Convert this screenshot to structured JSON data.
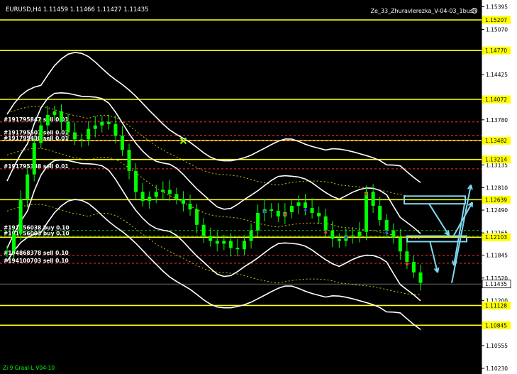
{
  "header": {
    "symbol_info": "EURUSD,H4  1.11459 1.11466 1.11427 1.11435",
    "indicator_name": "Ze_33_Zhuravlerezka_V-04-03_1bush"
  },
  "footer": {
    "indicator_label": "Zi 9 Graal-L  V04-10"
  },
  "colors": {
    "background": "#000000",
    "candle": "#00ff00",
    "level_line": "#ffff00",
    "band_line": "#ffffff",
    "ma_dotted": "#d4c000",
    "order_line_red": "#ff3030",
    "order_line_green": "#00c000",
    "arrow": "#7fd8f0",
    "axis_label_bg": "#ffff00"
  },
  "chart_data": {
    "type": "candlestick",
    "symbol": "EURUSD",
    "timeframe": "H4",
    "ohlc_current": {
      "open": 1.11459,
      "high": 1.11466,
      "low": 1.11427,
      "close": 1.11435
    },
    "ylim": [
      1.1021,
      1.1541
    ],
    "y_ticks": [
      1.15395,
      1.1507,
      1.14425,
      1.1378,
      1.13135,
      1.1281,
      1.1249,
      1.12165,
      1.11845,
      1.1152,
      1.112,
      1.10555,
      1.1023
    ],
    "y_tick_labels": [
      "1.15395",
      "1.15070",
      "1.14425",
      "1.13780",
      "1.13135",
      "1.12810",
      "1.12490",
      "1.12165",
      "1.11845",
      "1.11520",
      "1.11200",
      "1.10555",
      "1.10230"
    ],
    "current_price": 1.11435,
    "current_price_label": "1.11435",
    "levels": [
      1.15207,
      1.1477,
      1.14072,
      1.13482,
      1.13214,
      1.12639,
      1.12103,
      1.11128,
      1.10845
    ],
    "level_labels": [
      "1.15207",
      "1.14770",
      "1.14072",
      "1.13482",
      "1.13214",
      "1.12639",
      "1.12103",
      "1.11128",
      "1.10845"
    ],
    "orders": [
      {
        "label": "#191795847 sell 0.01",
        "price": 1.1375,
        "color": "red"
      },
      {
        "label": "#191795507 sell 0.01",
        "price": 1.1356,
        "color": "red"
      },
      {
        "label": "#191795430 sell 0.01",
        "price": 1.1348,
        "color": "red"
      },
      {
        "label": "#191795338 sell 0.01",
        "price": 1.1308,
        "color": "red"
      },
      {
        "label": "#191756038 buy 0.10",
        "price": 1.122,
        "color": "green"
      },
      {
        "label": "#191756003 buy 0.10",
        "price": 1.1212,
        "color": "green"
      },
      {
        "label": "#194868378 sell 0.10",
        "price": 1.1184,
        "color": "red"
      },
      {
        "label": "#194100703 sell 0.10",
        "price": 1.1173,
        "color": "red"
      }
    ],
    "close_series": [
      1.119,
      1.1215,
      1.1265,
      1.13,
      1.1345,
      1.137,
      1.1385,
      1.139,
      1.1375,
      1.136,
      1.135,
      1.135,
      1.1365,
      1.137,
      1.1375,
      1.1372,
      1.1355,
      1.1335,
      1.1305,
      1.1275,
      1.1262,
      1.1268,
      1.1275,
      1.1278,
      1.1272,
      1.1265,
      1.1258,
      1.125,
      1.1228,
      1.1212,
      1.1205,
      1.1201,
      1.1205,
      1.1195,
      1.1193,
      1.1205,
      1.122,
      1.1245,
      1.125,
      1.1248,
      1.124,
      1.1246,
      1.1255,
      1.126,
      1.1252,
      1.1245,
      1.124,
      1.122,
      1.1208,
      1.1205,
      1.1213,
      1.1212,
      1.1218,
      1.1275,
      1.1255,
      1.1235,
      1.122,
      1.121,
      1.119,
      1.1175,
      1.116,
      1.1145
    ]
  }
}
